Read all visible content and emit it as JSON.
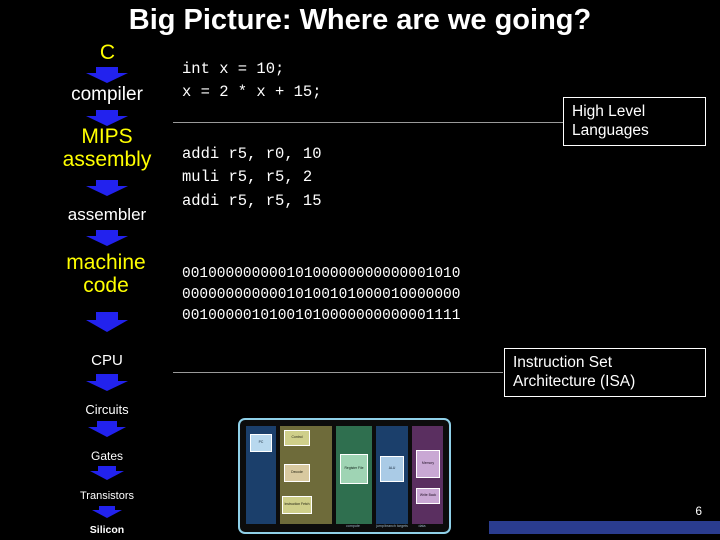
{
  "slide": {
    "title": "Big Picture: Where are we going?",
    "page_number": "6"
  },
  "levels": [
    {
      "label": "C",
      "color": "#ffff00"
    },
    {
      "label": "compiler",
      "color": "#ffffff"
    },
    {
      "label": "MIPS\nassembly",
      "line1": "MIPS",
      "line2": "assembly",
      "color": "#ffff00"
    },
    {
      "label": "assembler",
      "color": "#ffffff"
    },
    {
      "label": "machine\ncode",
      "line1": "machine",
      "line2": "code",
      "color": "#ffff00"
    },
    {
      "label": "CPU",
      "color": "#ffffff"
    },
    {
      "label": "Circuits",
      "color": "#ffffff"
    },
    {
      "label": "Gates",
      "color": "#ffffff"
    },
    {
      "label": "Transistors",
      "color": "#ffffff"
    },
    {
      "label": "Silicon",
      "color": "#ffffff"
    }
  ],
  "code": {
    "c_source": "int x = 10;\nx = 2 * x + 15;",
    "assembly": "addi r5, r0, 10\nmuli r5, r5, 2\naddi r5, r5, 15",
    "machine": "00100000000010100000000000001010\n00000000000010100101000010000000\n00100000101001010000000000001111"
  },
  "callouts": {
    "high_level": "High Level\nLanguages",
    "high_level_line1": "High Level",
    "high_level_line2": "Languages",
    "isa": "Instruction Set\nArchitecture (ISA)",
    "isa_line1": "Instruction Set",
    "isa_line2": "Architecture (ISA)"
  },
  "chip": {
    "blocks": [
      {
        "text": "Control"
      },
      {
        "text": "PC"
      },
      {
        "text": "Instruction Fetch"
      },
      {
        "text": "Decode"
      },
      {
        "text": "Register File"
      },
      {
        "text": "ALU"
      },
      {
        "text": "Memory"
      },
      {
        "text": "Write Back"
      }
    ],
    "captions": [
      "compute",
      "jump/branch targets",
      "data",
      "memory"
    ]
  },
  "colors": {
    "arrow_blue": "#2222ee",
    "highlight_yellow": "#ffff00",
    "text_white": "#ffffff",
    "chip_border": "#8fd0e8",
    "bottom_bar": "#2a3c8f"
  }
}
